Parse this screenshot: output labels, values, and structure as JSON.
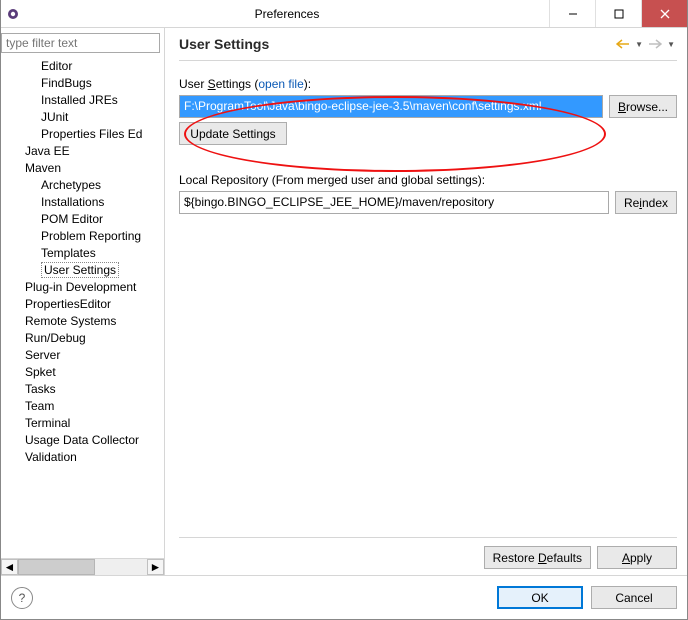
{
  "title": "Preferences",
  "filter_placeholder": "type filter text",
  "tree": {
    "editor": "Editor",
    "findbugs": "FindBugs",
    "installed_jres": "Installed JREs",
    "junit": "JUnit",
    "properties_files_ed": "Properties Files Ed",
    "java_ee": "Java EE",
    "maven": "Maven",
    "archetypes": "Archetypes",
    "installations": "Installations",
    "pom_editor": "POM Editor",
    "problem_reporting": "Problem Reporting",
    "templates": "Templates",
    "user_settings": "User Settings",
    "plugin_dev": "Plug-in Development",
    "properties_editor": "PropertiesEditor",
    "remote_systems": "Remote Systems",
    "run_debug": "Run/Debug",
    "server": "Server",
    "spket": "Spket",
    "tasks": "Tasks",
    "team": "Team",
    "terminal": "Terminal",
    "usage_data": "Usage Data Collector",
    "validation": "Validation"
  },
  "page": {
    "heading": "User Settings",
    "user_settings_label_pre": "User ",
    "user_settings_label_u": "S",
    "user_settings_label_post": "ettings (",
    "open_file": "open file",
    "user_settings_label_close": "):",
    "path": "F:\\ProgramTool\\Java\\bingo-eclipse-jee-3.5\\maven\\conf\\settings.xml",
    "browse_pre": "",
    "browse_u": "B",
    "browse_post": "rowse...",
    "update_settings": "Update Settings",
    "local_repo_label": "Local Repository (From merged user and global settings):",
    "local_repo_value": "${bingo.BINGO_ECLIPSE_JEE_HOME}/maven/repository",
    "reindex_pre": "Re",
    "reindex_u": "i",
    "reindex_post": "ndex",
    "restore_defaults": "Restore ",
    "restore_defaults_u": "D",
    "restore_defaults_post": "efaults",
    "apply_u": "A",
    "apply_post": "pply"
  },
  "footer": {
    "ok": "OK",
    "cancel": "Cancel"
  }
}
